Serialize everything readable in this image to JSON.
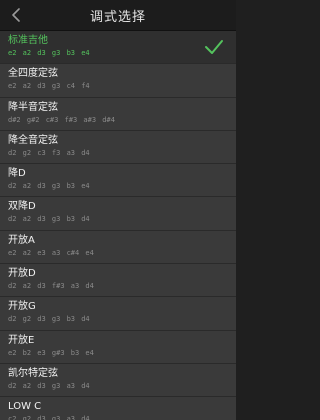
{
  "header": {
    "title": "调式选择"
  },
  "icons": {
    "back": "chevron-left-icon",
    "selected": "checkmark-icon"
  },
  "colors": {
    "accent": "#54c35d"
  },
  "tunings": [
    {
      "name": "标准吉他",
      "notes": "e2 a2 d3 g3 b3 e4",
      "selected": true
    },
    {
      "name": "全四度定弦",
      "notes": "e2 a2 d3 g3 c4 f4",
      "selected": false
    },
    {
      "name": "降半音定弦",
      "notes": "d#2 g#2 c#3 f#3 a#3 d#4",
      "selected": false
    },
    {
      "name": "降全音定弦",
      "notes": "d2 g2 c3 f3 a3 d4",
      "selected": false
    },
    {
      "name": "降D",
      "notes": "d2 a2 d3 g3 b3 e4",
      "selected": false
    },
    {
      "name": "双降D",
      "notes": "d2 a2 d3 g3 b3 d4",
      "selected": false
    },
    {
      "name": "开放A",
      "notes": "e2 a2 e3 a3 c#4 e4",
      "selected": false
    },
    {
      "name": "开放D",
      "notes": "d2 a2 d3 f#3 a3 d4",
      "selected": false
    },
    {
      "name": "开放G",
      "notes": "d2 g2 d3 g3 b3 d4",
      "selected": false
    },
    {
      "name": "开放E",
      "notes": "e2 b2 e3 g#3 b3 e4",
      "selected": false
    },
    {
      "name": "凯尔特定弦",
      "notes": "d2 a2 d3 g3 a3 d4",
      "selected": false
    },
    {
      "name": "LOW C",
      "notes": "c2 g2 d3 g3 a3 d4",
      "selected": false
    }
  ]
}
